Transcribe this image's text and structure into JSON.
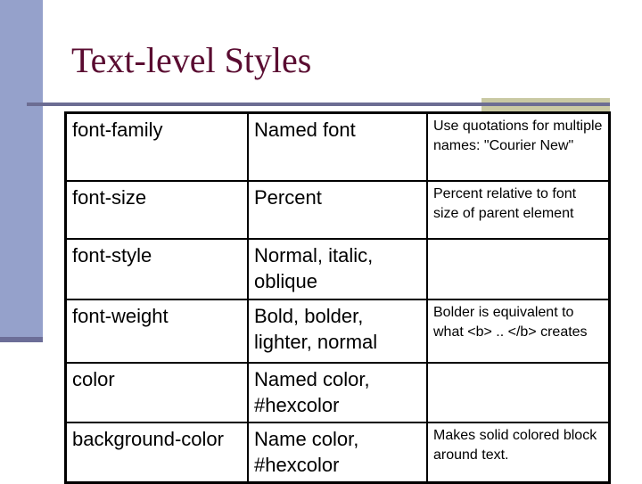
{
  "slide": {
    "title": "Text-level Styles",
    "colors": {
      "title": "#5a0c31",
      "side_bar": "#95a1cb",
      "rule": "#6c6d93",
      "accent_band": "#c9c9a3"
    }
  },
  "table": {
    "rows": [
      {
        "property": "font-family",
        "values": "Named font",
        "notes": "Use quotations for multiple names: \"Courier New\""
      },
      {
        "property": "font-size",
        "values": "Percent",
        "notes": "Percent relative to font size of parent element"
      },
      {
        "property": "font-style",
        "values": "Normal, italic, oblique",
        "notes": ""
      },
      {
        "property": "font-weight",
        "values": "Bold, bolder, lighter, normal",
        "notes": "Bolder is equivalent to what <b> .. </b> creates"
      },
      {
        "property": "color",
        "values": "Named color, #hexcolor",
        "notes": ""
      },
      {
        "property": "background-color",
        "values": "Name color, #hexcolor",
        "notes": "Makes solid colored block around text."
      }
    ]
  }
}
